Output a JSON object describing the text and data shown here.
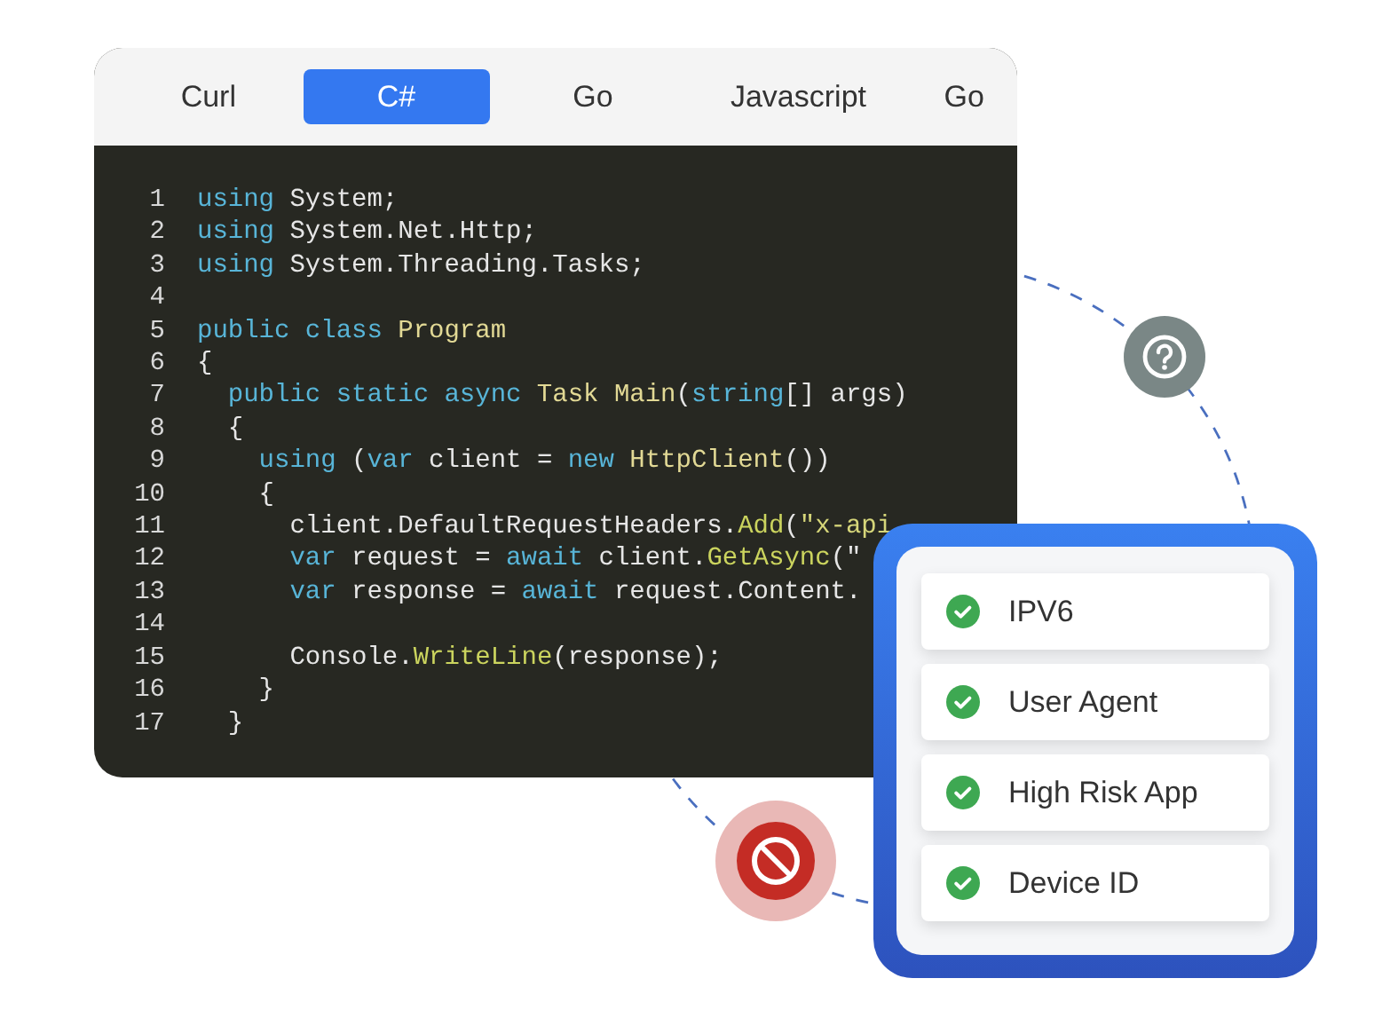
{
  "tabs": [
    {
      "label": "Curl",
      "selected": false
    },
    {
      "label": "C#",
      "selected": true
    },
    {
      "label": "Go",
      "selected": false
    },
    {
      "label": "Javascript",
      "selected": false
    },
    {
      "label": "Go",
      "selected": false
    }
  ],
  "code": [
    {
      "number": "1",
      "tokens": [
        {
          "kind": "kw",
          "text": "using"
        },
        {
          "kind": "plain",
          "text": " System;"
        }
      ]
    },
    {
      "number": "2",
      "tokens": [
        {
          "kind": "kw",
          "text": "using"
        },
        {
          "kind": "plain",
          "text": " System.Net.Http;"
        }
      ]
    },
    {
      "number": "3",
      "tokens": [
        {
          "kind": "kw",
          "text": "using"
        },
        {
          "kind": "plain",
          "text": " System.Threading.Tasks;"
        }
      ]
    },
    {
      "number": "4"
    },
    {
      "number": "5",
      "tokens": [
        {
          "kind": "kw",
          "text": "public class"
        },
        {
          "kind": "type",
          "text": " Program"
        }
      ]
    },
    {
      "number": "6",
      "tokens": [
        {
          "kind": "plain",
          "text": "{"
        }
      ]
    },
    {
      "number": "7",
      "tokens": [
        {
          "kind": "kw",
          "text": "  public static async"
        },
        {
          "kind": "type",
          "text": " Task Main"
        },
        {
          "kind": "plain",
          "text": "("
        },
        {
          "kind": "kw",
          "text": "string"
        },
        {
          "kind": "plain",
          "text": "[] args)"
        }
      ]
    },
    {
      "number": "8",
      "tokens": [
        {
          "kind": "plain",
          "text": "  {"
        }
      ]
    },
    {
      "number": "9",
      "tokens": [
        {
          "kind": "kw",
          "text": "    using"
        },
        {
          "kind": "plain",
          "text": " ("
        },
        {
          "kind": "kw",
          "text": "var"
        },
        {
          "kind": "plain",
          "text": " client = "
        },
        {
          "kind": "kw",
          "text": "new"
        },
        {
          "kind": "type",
          "text": " HttpClient"
        },
        {
          "kind": "plain",
          "text": "())"
        }
      ]
    },
    {
      "number": "10",
      "tokens": [
        {
          "kind": "plain",
          "text": "    {"
        }
      ]
    },
    {
      "number": "11",
      "tokens": [
        {
          "kind": "plain",
          "text": "      client.DefaultRequestHeaders."
        },
        {
          "kind": "fn",
          "text": "Add"
        },
        {
          "kind": "plain",
          "text": "("
        },
        {
          "kind": "str",
          "text": "\"x-api"
        }
      ]
    },
    {
      "number": "12",
      "tokens": [
        {
          "kind": "kw",
          "text": "      var"
        },
        {
          "kind": "plain",
          "text": " request = "
        },
        {
          "kind": "kw",
          "text": "await"
        },
        {
          "kind": "plain",
          "text": " client."
        },
        {
          "kind": "fn",
          "text": "GetAsync"
        },
        {
          "kind": "plain",
          "text": "(\""
        }
      ]
    },
    {
      "number": "13",
      "tokens": [
        {
          "kind": "kw",
          "text": "      var"
        },
        {
          "kind": "plain",
          "text": " response = "
        },
        {
          "kind": "kw",
          "text": "await"
        },
        {
          "kind": "plain",
          "text": " request.Content."
        }
      ]
    },
    {
      "number": "14"
    },
    {
      "number": "15",
      "tokens": [
        {
          "kind": "plain",
          "text": "      Console."
        },
        {
          "kind": "fn",
          "text": "WriteLine"
        },
        {
          "kind": "plain",
          "text": "(response);"
        }
      ]
    },
    {
      "number": "16",
      "tokens": [
        {
          "kind": "plain",
          "text": "    }"
        }
      ]
    },
    {
      "number": "17",
      "tokens": [
        {
          "kind": "plain",
          "text": "  }"
        }
      ]
    }
  ],
  "checks": [
    {
      "label": "IPV6",
      "checked": true
    },
    {
      "label": "User Agent",
      "checked": true
    },
    {
      "label": "High Risk App",
      "checked": true
    },
    {
      "label": "Device ID",
      "checked": true
    }
  ]
}
